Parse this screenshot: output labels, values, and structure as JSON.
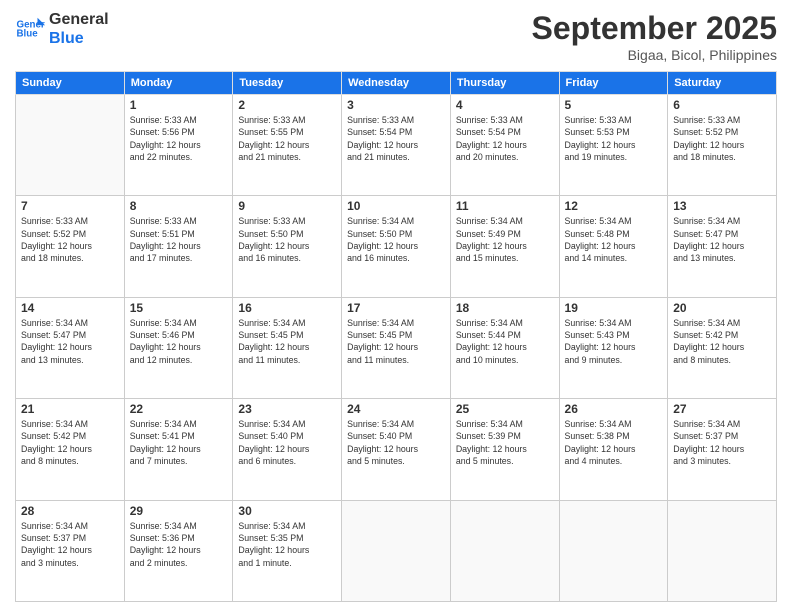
{
  "header": {
    "logo_line1": "General",
    "logo_line2": "Blue",
    "month": "September 2025",
    "location": "Bigaa, Bicol, Philippines"
  },
  "days_of_week": [
    "Sunday",
    "Monday",
    "Tuesday",
    "Wednesday",
    "Thursday",
    "Friday",
    "Saturday"
  ],
  "weeks": [
    [
      {
        "day": "",
        "info": ""
      },
      {
        "day": "1",
        "info": "Sunrise: 5:33 AM\nSunset: 5:56 PM\nDaylight: 12 hours\nand 22 minutes."
      },
      {
        "day": "2",
        "info": "Sunrise: 5:33 AM\nSunset: 5:55 PM\nDaylight: 12 hours\nand 21 minutes."
      },
      {
        "day": "3",
        "info": "Sunrise: 5:33 AM\nSunset: 5:54 PM\nDaylight: 12 hours\nand 21 minutes."
      },
      {
        "day": "4",
        "info": "Sunrise: 5:33 AM\nSunset: 5:54 PM\nDaylight: 12 hours\nand 20 minutes."
      },
      {
        "day": "5",
        "info": "Sunrise: 5:33 AM\nSunset: 5:53 PM\nDaylight: 12 hours\nand 19 minutes."
      },
      {
        "day": "6",
        "info": "Sunrise: 5:33 AM\nSunset: 5:52 PM\nDaylight: 12 hours\nand 18 minutes."
      }
    ],
    [
      {
        "day": "7",
        "info": "Sunrise: 5:33 AM\nSunset: 5:52 PM\nDaylight: 12 hours\nand 18 minutes."
      },
      {
        "day": "8",
        "info": "Sunrise: 5:33 AM\nSunset: 5:51 PM\nDaylight: 12 hours\nand 17 minutes."
      },
      {
        "day": "9",
        "info": "Sunrise: 5:33 AM\nSunset: 5:50 PM\nDaylight: 12 hours\nand 16 minutes."
      },
      {
        "day": "10",
        "info": "Sunrise: 5:34 AM\nSunset: 5:50 PM\nDaylight: 12 hours\nand 16 minutes."
      },
      {
        "day": "11",
        "info": "Sunrise: 5:34 AM\nSunset: 5:49 PM\nDaylight: 12 hours\nand 15 minutes."
      },
      {
        "day": "12",
        "info": "Sunrise: 5:34 AM\nSunset: 5:48 PM\nDaylight: 12 hours\nand 14 minutes."
      },
      {
        "day": "13",
        "info": "Sunrise: 5:34 AM\nSunset: 5:47 PM\nDaylight: 12 hours\nand 13 minutes."
      }
    ],
    [
      {
        "day": "14",
        "info": "Sunrise: 5:34 AM\nSunset: 5:47 PM\nDaylight: 12 hours\nand 13 minutes."
      },
      {
        "day": "15",
        "info": "Sunrise: 5:34 AM\nSunset: 5:46 PM\nDaylight: 12 hours\nand 12 minutes."
      },
      {
        "day": "16",
        "info": "Sunrise: 5:34 AM\nSunset: 5:45 PM\nDaylight: 12 hours\nand 11 minutes."
      },
      {
        "day": "17",
        "info": "Sunrise: 5:34 AM\nSunset: 5:45 PM\nDaylight: 12 hours\nand 11 minutes."
      },
      {
        "day": "18",
        "info": "Sunrise: 5:34 AM\nSunset: 5:44 PM\nDaylight: 12 hours\nand 10 minutes."
      },
      {
        "day": "19",
        "info": "Sunrise: 5:34 AM\nSunset: 5:43 PM\nDaylight: 12 hours\nand 9 minutes."
      },
      {
        "day": "20",
        "info": "Sunrise: 5:34 AM\nSunset: 5:42 PM\nDaylight: 12 hours\nand 8 minutes."
      }
    ],
    [
      {
        "day": "21",
        "info": "Sunrise: 5:34 AM\nSunset: 5:42 PM\nDaylight: 12 hours\nand 8 minutes."
      },
      {
        "day": "22",
        "info": "Sunrise: 5:34 AM\nSunset: 5:41 PM\nDaylight: 12 hours\nand 7 minutes."
      },
      {
        "day": "23",
        "info": "Sunrise: 5:34 AM\nSunset: 5:40 PM\nDaylight: 12 hours\nand 6 minutes."
      },
      {
        "day": "24",
        "info": "Sunrise: 5:34 AM\nSunset: 5:40 PM\nDaylight: 12 hours\nand 5 minutes."
      },
      {
        "day": "25",
        "info": "Sunrise: 5:34 AM\nSunset: 5:39 PM\nDaylight: 12 hours\nand 5 minutes."
      },
      {
        "day": "26",
        "info": "Sunrise: 5:34 AM\nSunset: 5:38 PM\nDaylight: 12 hours\nand 4 minutes."
      },
      {
        "day": "27",
        "info": "Sunrise: 5:34 AM\nSunset: 5:37 PM\nDaylight: 12 hours\nand 3 minutes."
      }
    ],
    [
      {
        "day": "28",
        "info": "Sunrise: 5:34 AM\nSunset: 5:37 PM\nDaylight: 12 hours\nand 3 minutes."
      },
      {
        "day": "29",
        "info": "Sunrise: 5:34 AM\nSunset: 5:36 PM\nDaylight: 12 hours\nand 2 minutes."
      },
      {
        "day": "30",
        "info": "Sunrise: 5:34 AM\nSunset: 5:35 PM\nDaylight: 12 hours\nand 1 minute."
      },
      {
        "day": "",
        "info": ""
      },
      {
        "day": "",
        "info": ""
      },
      {
        "day": "",
        "info": ""
      },
      {
        "day": "",
        "info": ""
      }
    ]
  ]
}
